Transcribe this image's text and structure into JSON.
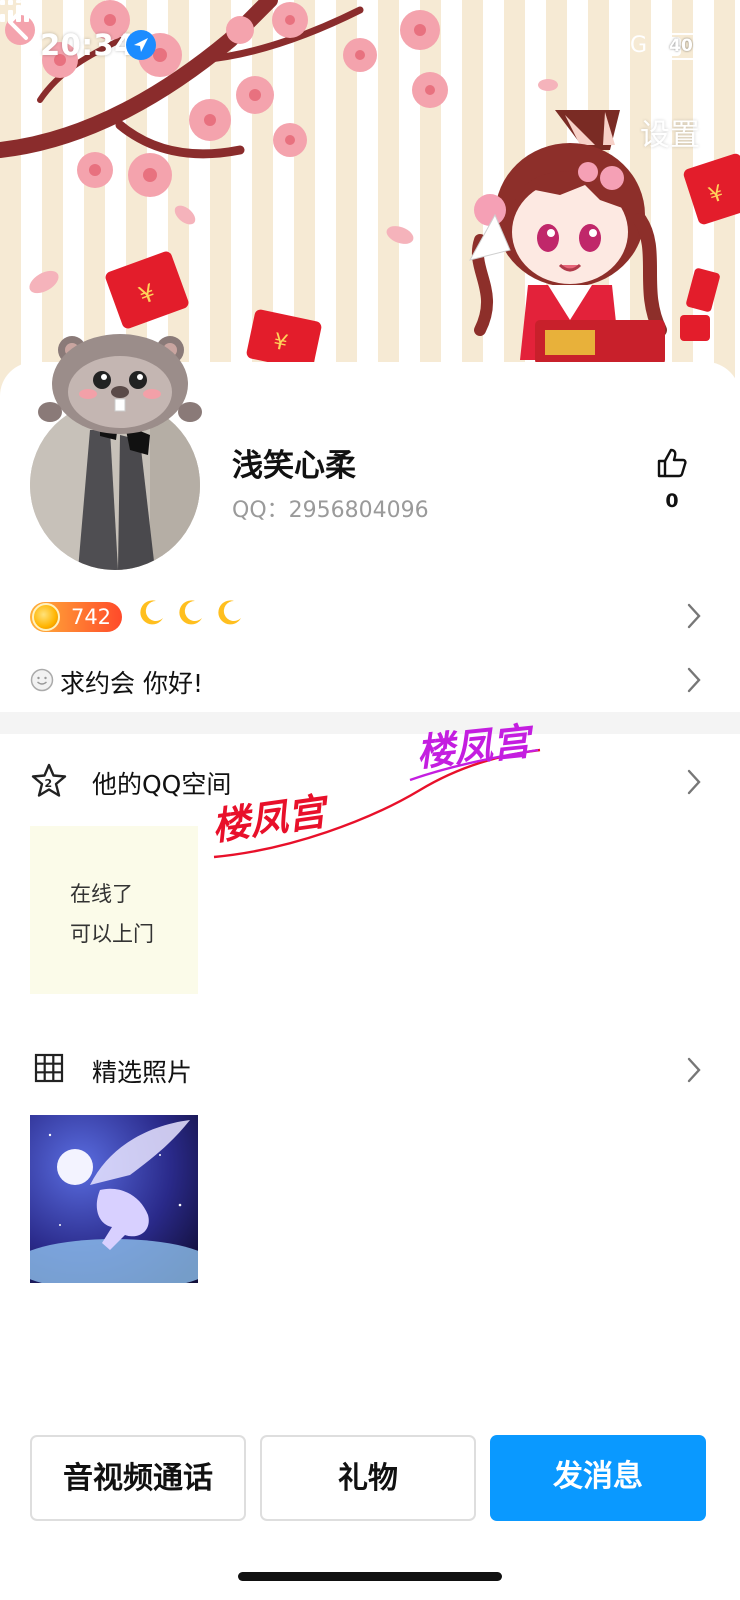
{
  "status_bar": {
    "time": "20:34",
    "network": "5G",
    "battery": "40",
    "location_icon": "location-arrow-icon",
    "signal_icon": "signal-bars-icon"
  },
  "nav": {
    "back_icon": "chevron-left-icon",
    "settings_label": "设置"
  },
  "profile": {
    "nickname": "浅笑心柔",
    "qq_label": "QQ：2956804096",
    "like_count": "0",
    "like_icon": "thumbs-up-icon"
  },
  "level": {
    "badge_value": "742",
    "moon_icon": "crescent-moon-icon",
    "moons": 3
  },
  "signature": {
    "icon": "smile-icon",
    "text": "求约会 你好!"
  },
  "qzone": {
    "icon": "star-icon",
    "title": "他的QQ空间",
    "post_lines": [
      "在线了",
      "可以上门"
    ]
  },
  "watermark": {
    "text_1": "楼凤宫",
    "text_2": "楼凤宫"
  },
  "photos": {
    "icon": "grid-icon",
    "title": "精选照片"
  },
  "actions": {
    "av_call": "音视频通话",
    "gift": "礼物",
    "send_message": "发消息"
  },
  "colors": {
    "primary_blue": "#0a99ff",
    "badge_orange": "#ff5a2a",
    "watermark_red": "#e8102a",
    "watermark_purple": "#c41ee0"
  }
}
